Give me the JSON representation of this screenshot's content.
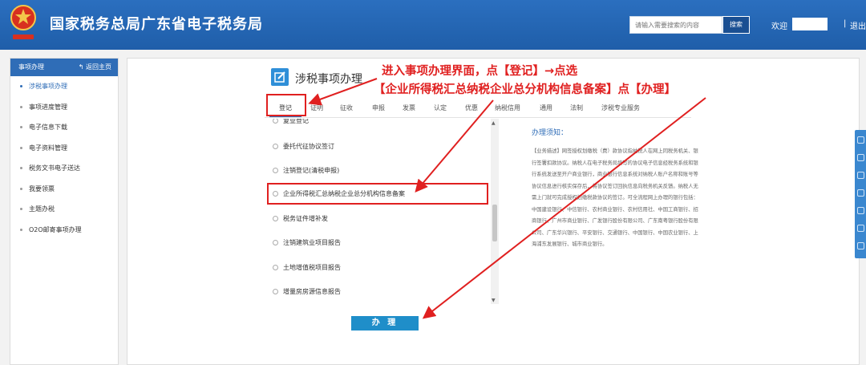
{
  "header": {
    "site_title": "国家税务总局广东省电子税务局",
    "search_placeholder": "请输入需要搜索的内容",
    "search_button": "搜索",
    "welcome": "欢迎",
    "separator": "|",
    "logout": "退出"
  },
  "sidebar": {
    "title": "事项办理",
    "back_home": "返回主页",
    "items": [
      {
        "label": "涉税事项办理"
      },
      {
        "label": "事项进度管理"
      },
      {
        "label": "电子信息下载"
      },
      {
        "label": "电子资料管理"
      },
      {
        "label": "税务文书电子送达"
      },
      {
        "label": "我要领票"
      },
      {
        "label": "主题办税"
      },
      {
        "label": "O2O邮寄事项办理"
      }
    ]
  },
  "main": {
    "page_title": "涉税事项办理",
    "tabs": [
      "登记",
      "证明",
      "征收",
      "申报",
      "发票",
      "认定",
      "优惠",
      "纳税信用",
      "通用",
      "法制",
      "涉税专业服务"
    ],
    "list_items": [
      "复业登记",
      "委托代征协议签订",
      "注销登记(清税申报)",
      "企业所得税汇总纳税企业总分机构信息备案",
      "税务证件增补发",
      "注销建筑业项目报告",
      "土地增值税项目报告",
      "增量房房源信息报告"
    ],
    "notice_title": "办理须知：",
    "notice_body": "【业务描述】网签授权划缴税（费）款协议指纳税人在网上同税务机关、银行签署扣款协议。纳税人在电子税务局填写的协议电子信息经税务系统和银行系统发送至开户商业银行，商业银行信息系统对纳税人账户名称和账号等协议信息进行核实保存后，将协议签订回执信息向税务机关反馈。纳税人无需上门就可完成授权划缴税款协议的签订。可全流程网上办理的银行包括：中国建设银行、中信银行、农村商业银行、农村信用社、中国工商银行、招商银行、广州市商业银行、广发银行股份有限公司、广东南粤银行股份有限公司、广东华兴银行、平安银行、交通银行、中国银行、中国农业银行、上海浦东发展银行、城市商业银行。",
    "handle_button": "办 理"
  },
  "annotation": {
    "line1": "进入事项办理界面，点【登记】→点选",
    "line2": "【企业所得税汇总纳税企业总分机构信息备案】点【办理】",
    "color": "#e02020"
  }
}
